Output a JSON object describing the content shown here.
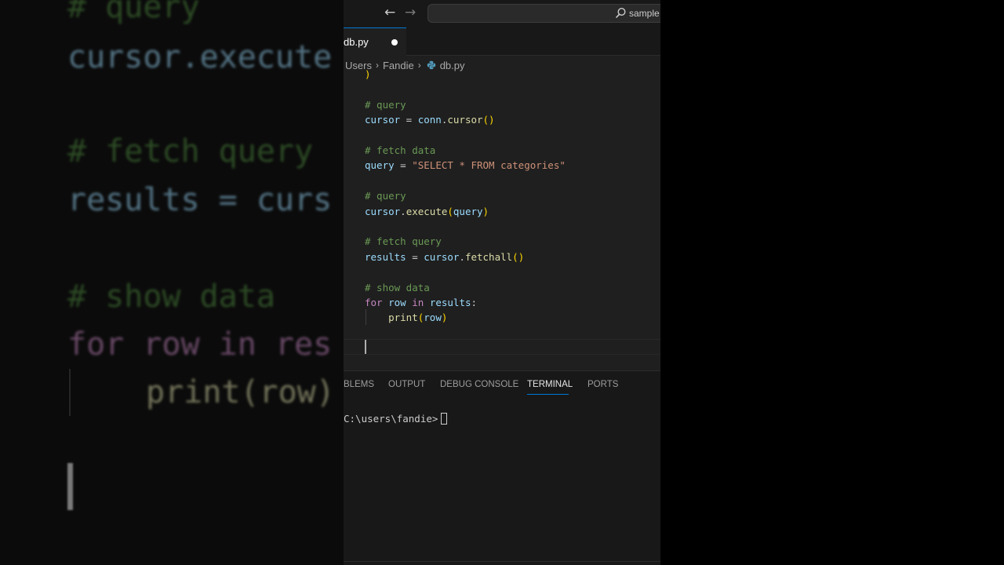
{
  "background": {
    "lines": [
      {
        "class": "c-comment",
        "text": "# query"
      },
      {
        "class": "c-var",
        "text": "cursor.execute"
      },
      {
        "class": "c-comment",
        "text": "# fetch query"
      },
      {
        "class": "c-var",
        "text": "results = curs"
      },
      {
        "class": "c-comment",
        "text": "# show data"
      },
      {
        "class": "c-kw",
        "text": "for row in res"
      },
      {
        "class": "c-fn",
        "text": "print(row)"
      }
    ]
  },
  "titlebar": {
    "back_icon": "arrow-left-icon",
    "forward_icon": "arrow-right-icon",
    "search_icon": "search-icon",
    "command_center_text": "sample"
  },
  "tabs": [
    {
      "label": "db.py",
      "active": true,
      "dirty": true
    }
  ],
  "breadcrumb": [
    "Users",
    "Fandie",
    "db.py"
  ],
  "editor": {
    "lines": [
      [
        {
          "c": "par",
          "t": ")"
        }
      ],
      [],
      [
        {
          "c": "comment",
          "t": "# query"
        }
      ],
      [
        {
          "c": "var",
          "t": "cursor"
        },
        {
          "c": "pun",
          "t": " = "
        },
        {
          "c": "var",
          "t": "conn"
        },
        {
          "c": "pun",
          "t": "."
        },
        {
          "c": "fn",
          "t": "cursor"
        },
        {
          "c": "par",
          "t": "()"
        }
      ],
      [],
      [
        {
          "c": "comment",
          "t": "# fetch data"
        }
      ],
      [
        {
          "c": "var",
          "t": "query"
        },
        {
          "c": "pun",
          "t": " = "
        },
        {
          "c": "str",
          "t": "\"SELECT * FROM categories\""
        }
      ],
      [],
      [
        {
          "c": "comment",
          "t": "# query"
        }
      ],
      [
        {
          "c": "var",
          "t": "cursor"
        },
        {
          "c": "pun",
          "t": "."
        },
        {
          "c": "fn",
          "t": "execute"
        },
        {
          "c": "par",
          "t": "("
        },
        {
          "c": "var",
          "t": "query"
        },
        {
          "c": "par",
          "t": ")"
        }
      ],
      [],
      [
        {
          "c": "comment",
          "t": "# fetch query"
        }
      ],
      [
        {
          "c": "var",
          "t": "results"
        },
        {
          "c": "pun",
          "t": " = "
        },
        {
          "c": "var",
          "t": "cursor"
        },
        {
          "c": "pun",
          "t": "."
        },
        {
          "c": "fn",
          "t": "fetchall"
        },
        {
          "c": "par",
          "t": "()"
        }
      ],
      [],
      [
        {
          "c": "comment",
          "t": "# show data"
        }
      ],
      [
        {
          "c": "kw",
          "t": "for"
        },
        {
          "c": "pun",
          "t": " "
        },
        {
          "c": "var",
          "t": "row"
        },
        {
          "c": "pun",
          "t": " "
        },
        {
          "c": "kw",
          "t": "in"
        },
        {
          "c": "pun",
          "t": " "
        },
        {
          "c": "var",
          "t": "results"
        },
        {
          "c": "pun",
          "t": ":"
        }
      ],
      [
        {
          "c": "pun",
          "t": "    "
        },
        {
          "c": "fn",
          "t": "print"
        },
        {
          "c": "par",
          "t": "("
        },
        {
          "c": "var",
          "t": "row"
        },
        {
          "c": "par",
          "t": ")"
        }
      ],
      [],
      []
    ]
  },
  "panel": {
    "tabs": {
      "problems": "BLEMS",
      "output": "OUTPUT",
      "debug_console": "DEBUG CONSOLE",
      "terminal": "TERMINAL",
      "ports": "PORTS"
    },
    "active_tab": "TERMINAL",
    "terminal_prompt": "C:\\users\\fandie>"
  },
  "colors": {
    "accent": "#0078d4",
    "editor_bg": "#1f1f1f",
    "chrome_bg": "#181818"
  }
}
